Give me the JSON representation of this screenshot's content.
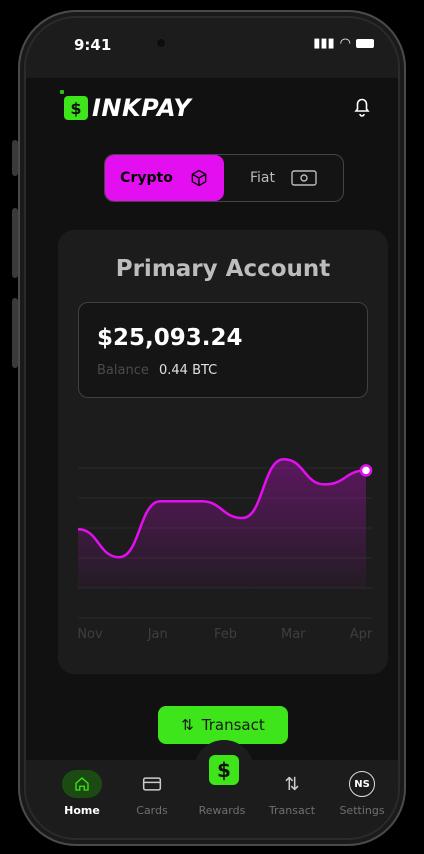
{
  "status": {
    "time": "9:41"
  },
  "brand": {
    "name": "INKPAY",
    "badge_glyph": "$",
    "accent": "#3ee51a",
    "magenta": "#e40ff0"
  },
  "toggle": {
    "crypto_label": "Crypto",
    "fiat_label": "Fiat",
    "selected": "Crypto"
  },
  "account": {
    "title": "Primary Account",
    "balance": "$25,093.24",
    "balance_label": "Balance",
    "btc_value": "0.44 BTC"
  },
  "chart_data": {
    "type": "line",
    "categories": [
      "Nov",
      "Jan",
      "Feb",
      "Mar",
      "Apr"
    ],
    "series": [
      {
        "values": [
          0.42,
          0.22,
          0.62,
          0.62,
          0.5,
          0.92,
          0.74,
          0.84
        ]
      }
    ],
    "title": "",
    "xlabel": "",
    "ylabel": "",
    "ylim": [
      0,
      1
    ],
    "grid": true
  },
  "actions": {
    "transact_label": "Transact"
  },
  "nav": {
    "home": "Home",
    "cards": "Cards",
    "rewards": "Rewards",
    "transact": "Transact",
    "settings": "Settings",
    "settings_initials": "NS"
  }
}
